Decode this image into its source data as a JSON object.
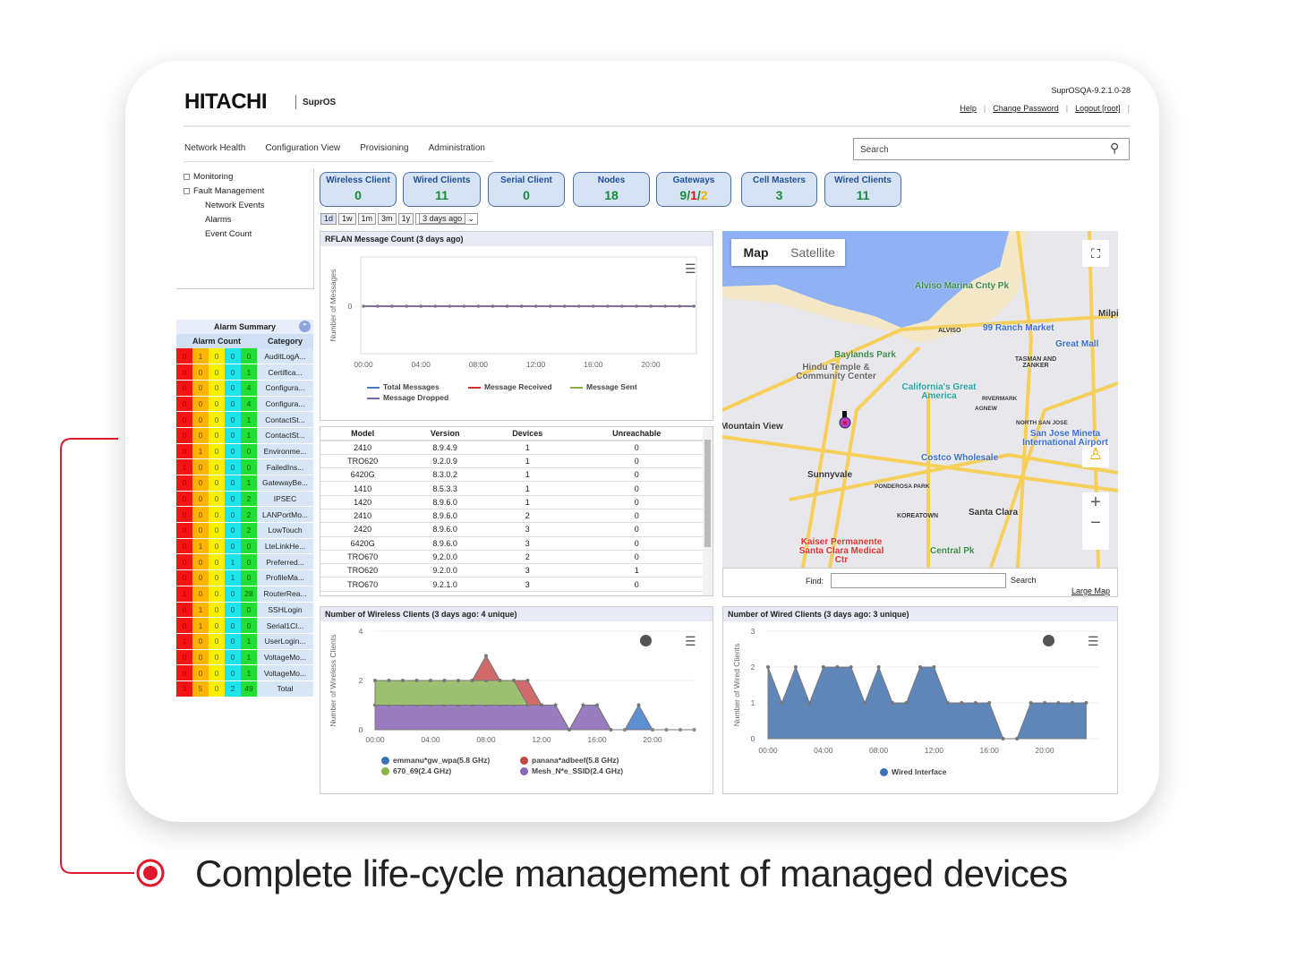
{
  "header": {
    "logo": "HITACHI",
    "product": "SuprOS",
    "version": "SuprOSQA-9.2.1.0-28",
    "links": [
      "Help",
      "Change Password",
      "Logout [root]"
    ]
  },
  "nav": [
    "Network Health",
    "Configuration View",
    "Provisioning",
    "Administration"
  ],
  "search": {
    "placeholder": "Search"
  },
  "tree": [
    "Monitoring",
    "Fault Management",
    "Network Events",
    "Alarms",
    "Event Count"
  ],
  "tiles": [
    {
      "label": "Wireless Client",
      "value": "0"
    },
    {
      "label": "Wired Clients",
      "value": "11"
    },
    {
      "label": "Serial Client",
      "value": "0"
    },
    {
      "label": "Nodes",
      "value": "18"
    },
    {
      "label": "Gateways",
      "value_parts": [
        "9",
        "1",
        "2"
      ],
      "value_colors": [
        "#1a8a3a",
        "#e01010",
        "#f0b000"
      ]
    },
    {
      "label": "Cell Masters",
      "value": "3"
    },
    {
      "label": "Wired Clients",
      "value": "11"
    }
  ],
  "ranges": [
    "1d",
    "1w",
    "1m",
    "3m",
    "1y"
  ],
  "range_select": "3 days ago",
  "alarm": {
    "title": "Alarm Summary",
    "col_count": "Alarm Count",
    "col_category": "Category",
    "severity_colors": [
      "#f41414",
      "#ffb400",
      "#f8f000",
      "#1de4e8",
      "#22dd33"
    ],
    "rows": [
      {
        "c": [
          0,
          1,
          0,
          0,
          0
        ],
        "cat": "AuditLogA..."
      },
      {
        "c": [
          0,
          0,
          0,
          0,
          1
        ],
        "cat": "Certifica..."
      },
      {
        "c": [
          0,
          0,
          0,
          0,
          4
        ],
        "cat": "Configura..."
      },
      {
        "c": [
          0,
          0,
          0,
          0,
          4
        ],
        "cat": "Configura..."
      },
      {
        "c": [
          0,
          0,
          0,
          0,
          1
        ],
        "cat": "ContactSt..."
      },
      {
        "c": [
          0,
          0,
          0,
          0,
          1
        ],
        "cat": "ContactSt..."
      },
      {
        "c": [
          0,
          1,
          0,
          0,
          0
        ],
        "cat": "Environme..."
      },
      {
        "c": [
          1,
          0,
          0,
          0,
          0
        ],
        "cat": "FailedIns..."
      },
      {
        "c": [
          0,
          0,
          0,
          0,
          1
        ],
        "cat": "GatewayBe..."
      },
      {
        "c": [
          0,
          0,
          0,
          0,
          2
        ],
        "cat": "IPSEC"
      },
      {
        "c": [
          0,
          0,
          0,
          0,
          2
        ],
        "cat": "LANPortMo..."
      },
      {
        "c": [
          0,
          0,
          0,
          0,
          2
        ],
        "cat": "LowTouch"
      },
      {
        "c": [
          0,
          1,
          0,
          0,
          0
        ],
        "cat": "LteLinkHe..."
      },
      {
        "c": [
          0,
          0,
          0,
          1,
          0
        ],
        "cat": "Preferred..."
      },
      {
        "c": [
          0,
          0,
          0,
          1,
          0
        ],
        "cat": "ProfileMa..."
      },
      {
        "c": [
          1,
          0,
          0,
          0,
          28
        ],
        "cat": "RouterRea..."
      },
      {
        "c": [
          0,
          1,
          0,
          0,
          0
        ],
        "cat": "SSHLogin"
      },
      {
        "c": [
          0,
          1,
          0,
          0,
          0
        ],
        "cat": "Serial1Cl..."
      },
      {
        "c": [
          1,
          0,
          0,
          0,
          1
        ],
        "cat": "UserLogin..."
      },
      {
        "c": [
          0,
          0,
          0,
          0,
          1
        ],
        "cat": "VoltageMo..."
      },
      {
        "c": [
          0,
          0,
          0,
          0,
          1
        ],
        "cat": "VoltageMo..."
      },
      {
        "c": [
          3,
          5,
          0,
          2,
          49
        ],
        "cat": "Total"
      }
    ]
  },
  "devices": {
    "headers": [
      "Model",
      "Version",
      "Devices",
      "Unreachable"
    ],
    "rows": [
      [
        "2410",
        "8.9.4.9",
        "1",
        "0"
      ],
      [
        "TRO620",
        "9.2.0.9",
        "1",
        "0"
      ],
      [
        "6420G",
        "8.3.0.2",
        "1",
        "0"
      ],
      [
        "1410",
        "8.5.3.3",
        "1",
        "0"
      ],
      [
        "1420",
        "8.9.6.0",
        "1",
        "0"
      ],
      [
        "2410",
        "8.9.6.0",
        "2",
        "0"
      ],
      [
        "2420",
        "8.9.6.0",
        "3",
        "0"
      ],
      [
        "6420G",
        "8.9.6.0",
        "3",
        "0"
      ],
      [
        "TRO670",
        "9.2.0.0",
        "2",
        "0"
      ],
      [
        "TRO620",
        "9.2.0.0",
        "3",
        "1"
      ],
      [
        "TRO670",
        "9.2.1.0",
        "3",
        "0"
      ]
    ]
  },
  "map": {
    "tabs": [
      "Map",
      "Satellite"
    ],
    "labels": [
      "Alviso Marina Cnty Pk",
      "ALVISO",
      "99 Ranch Market",
      "Milpitas",
      "Great Mall",
      "Baylands Park",
      "Hindu Temple & Community Center",
      "TASMAN AND ZANKER",
      "California's Great America",
      "RIVERMARK",
      "AGNEW",
      "NORTH SAN JOSE",
      "San Jose Mineta International Airport",
      "Mountain View",
      "Costco Wholesale",
      "Sunnyvale",
      "PONDEROSA PARK",
      "KOREATOWN",
      "Santa Clara",
      "Kaiser Permanente Santa Clara Medical Ctr",
      "Central Pk"
    ],
    "find_label": "Find:",
    "search_button": "Search",
    "large_map": "Large Map"
  },
  "chart_data": [
    {
      "type": "line",
      "title": "RFLAN Message Count (3 days ago)",
      "ylabel": "Number of Messages",
      "x": [
        0,
        1,
        2,
        3,
        4,
        5,
        6,
        7,
        8,
        9,
        10,
        11,
        12,
        13,
        14,
        15,
        16,
        17,
        18,
        19,
        20,
        21,
        22,
        23
      ],
      "xticks": [
        "00:00",
        "04:00",
        "08:00",
        "12:00",
        "16:00",
        "20:00"
      ],
      "yticks": [
        "0"
      ],
      "series": [
        {
          "name": "Total Messages",
          "color": "#4a78c8",
          "values": [
            0,
            0,
            0,
            0,
            0,
            0,
            0,
            0,
            0,
            0,
            0,
            0,
            0,
            0,
            0,
            0,
            0,
            0,
            0,
            0,
            0,
            0,
            0,
            0
          ]
        },
        {
          "name": "Message Received",
          "color": "#d03030",
          "values": [
            0,
            0,
            0,
            0,
            0,
            0,
            0,
            0,
            0,
            0,
            0,
            0,
            0,
            0,
            0,
            0,
            0,
            0,
            0,
            0,
            0,
            0,
            0,
            0
          ]
        },
        {
          "name": "Message Sent",
          "color": "#8ab040",
          "values": [
            0,
            0,
            0,
            0,
            0,
            0,
            0,
            0,
            0,
            0,
            0,
            0,
            0,
            0,
            0,
            0,
            0,
            0,
            0,
            0,
            0,
            0,
            0,
            0
          ]
        },
        {
          "name": "Message Dropped",
          "color": "#8060b0",
          "values": [
            0,
            0,
            0,
            0,
            0,
            0,
            0,
            0,
            0,
            0,
            0,
            0,
            0,
            0,
            0,
            0,
            0,
            0,
            0,
            0,
            0,
            0,
            0,
            0
          ]
        }
      ]
    },
    {
      "type": "area",
      "stacked": true,
      "title": "Number of Wireless Clients (3 days ago: 4 unique)",
      "ylabel": "Number of Wireless Clients",
      "ylim": [
        0,
        4
      ],
      "yticks": [
        "0",
        "2",
        "4"
      ],
      "xticks": [
        "00:00",
        "04:00",
        "08:00",
        "12:00",
        "16:00",
        "20:00"
      ],
      "x": [
        0,
        1,
        2,
        3,
        4,
        5,
        6,
        7,
        8,
        9,
        10,
        11,
        12,
        13,
        14,
        15,
        16,
        17,
        18,
        19,
        20,
        21,
        22,
        23
      ],
      "series": [
        {
          "name": "Mesh_N*e_SSID(2.4 GHz)",
          "color": "#9a7cc0",
          "values": [
            1,
            1,
            1,
            1,
            1,
            1,
            1,
            1,
            1,
            1,
            1,
            1,
            1,
            1,
            0,
            1,
            1,
            0,
            0,
            0,
            0,
            0,
            0,
            0
          ]
        },
        {
          "name": "670_69(2.4 GHz)",
          "color": "#9cc070",
          "values": [
            1,
            1,
            1,
            1,
            1,
            1,
            1,
            1,
            1,
            1,
            1,
            0,
            0,
            0,
            0,
            0,
            0,
            0,
            0,
            0,
            0,
            0,
            0,
            0
          ]
        },
        {
          "name": "panana*adbeef(5.8 GHz)",
          "color": "#d06a6a",
          "values": [
            0,
            0,
            0,
            0,
            0,
            0,
            0,
            0,
            1,
            0,
            0,
            1,
            0,
            0,
            0,
            0,
            0,
            0,
            0,
            0,
            0,
            0,
            0,
            0
          ]
        },
        {
          "name": "emmanu*gw_wpa(5.8 GHz)",
          "color": "#5b8fd0",
          "values": [
            0,
            0,
            0,
            0,
            0,
            0,
            0,
            0,
            0,
            0,
            0,
            0,
            0,
            0,
            0,
            0,
            0,
            0,
            0,
            1,
            0,
            0,
            0,
            0
          ]
        }
      ]
    },
    {
      "type": "area",
      "title": "Number of Wired Clients (3 days ago: 3 unique)",
      "ylabel": "Number of Wired Clients",
      "ylim": [
        0,
        3
      ],
      "yticks": [
        "0",
        "1",
        "2",
        "3"
      ],
      "xticks": [
        "00:00",
        "04:00",
        "08:00",
        "12:00",
        "16:00",
        "20:00"
      ],
      "x": [
        0,
        1,
        2,
        3,
        4,
        5,
        6,
        7,
        8,
        9,
        10,
        11,
        12,
        13,
        14,
        15,
        16,
        17,
        18,
        19,
        20,
        21,
        22,
        23
      ],
      "series": [
        {
          "name": "Wired Interface",
          "color": "#5f86b8",
          "values": [
            2,
            1,
            2,
            1,
            2,
            2,
            2,
            1,
            2,
            1,
            1,
            2,
            2,
            1,
            1,
            1,
            1,
            0,
            0,
            1,
            1,
            1,
            1,
            1
          ]
        }
      ]
    }
  ],
  "caption": "Complete life-cycle management of managed devices",
  "accent": "#e0182d"
}
